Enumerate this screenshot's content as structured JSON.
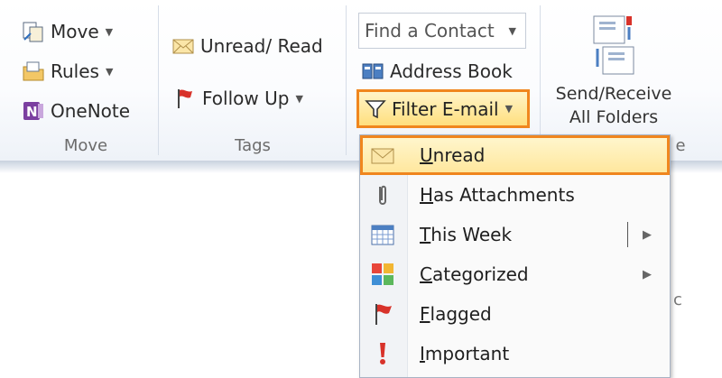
{
  "ribbon": {
    "move_group": {
      "move_label": "Move",
      "rules_label": "Rules",
      "onenote_label": "OneNote",
      "group_label": "Move"
    },
    "tags_group": {
      "unread_read_label": "Unread/ Read",
      "follow_up_label": "Follow Up",
      "group_label": "Tags"
    },
    "find_group": {
      "find_contact_placeholder": "Find a Contact",
      "address_book_label": "Address Book",
      "filter_email_label": "Filter E-mail",
      "group_label_fragment": "e"
    },
    "send_receive": {
      "line1": "Send/Receive",
      "line2": "All Folders"
    }
  },
  "filter_menu": {
    "items": [
      {
        "mnemonic": "U",
        "rest": "nread",
        "icon": "envelope-icon",
        "selected": true
      },
      {
        "mnemonic": "H",
        "rest": "as Attachments",
        "icon": "paperclip-icon"
      },
      {
        "mnemonic": "T",
        "rest": "his Week",
        "icon": "calendar-icon",
        "submenu": true
      },
      {
        "mnemonic": "C",
        "rest": "ategorized",
        "icon": "categories-icon",
        "submenu": true
      },
      {
        "mnemonic": "F",
        "rest": "lagged",
        "icon": "flag-icon"
      },
      {
        "mnemonic": "I",
        "rest": "mportant",
        "icon": "exclamation-icon"
      }
    ]
  },
  "background_fragment": "c",
  "colors": {
    "highlight_outline": "#f0861e",
    "selection_fill": "#ffe69a",
    "flag_red": "#d8322a"
  }
}
